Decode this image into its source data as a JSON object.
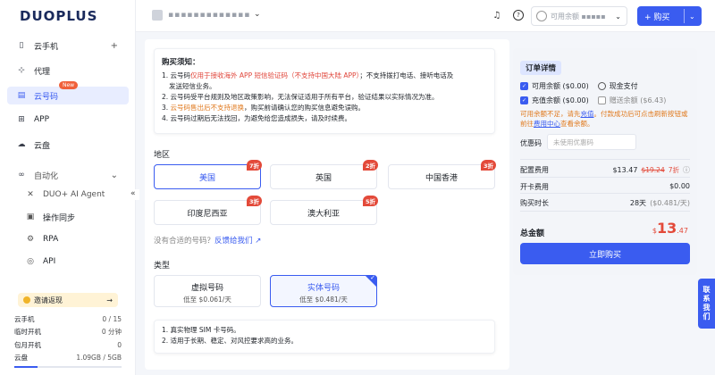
{
  "brand": {
    "logo": "DUOPLUS"
  },
  "sidebar": {
    "items": [
      {
        "label": "云手机",
        "icon": "phone-icon",
        "right": "+"
      },
      {
        "label": "代理",
        "icon": "network-icon"
      },
      {
        "label": "云号码",
        "icon": "sim-icon",
        "badge": "New"
      },
      {
        "label": "APP",
        "icon": "apps-grid-icon"
      },
      {
        "label": "云盘",
        "icon": "cloud-icon"
      },
      {
        "label": "自动化",
        "icon": "automation-icon",
        "right": "⌄"
      }
    ],
    "sub_items": [
      {
        "label": "DUO+ AI Agent",
        "icon": "ai-agent-icon"
      },
      {
        "label": "操作同步",
        "icon": "sync-icon"
      },
      {
        "label": "RPA",
        "icon": "rpa-icon"
      },
      {
        "label": "API",
        "icon": "api-icon"
      }
    ],
    "invite": {
      "label": "邀请返现",
      "arrow": "→"
    },
    "stats": [
      {
        "label": "云手机",
        "value": "0 / 15"
      },
      {
        "label": "临时开机",
        "value": "0 分钟"
      },
      {
        "label": "包月开机",
        "value": "0"
      },
      {
        "label": "云盘",
        "value": "1.09GB / 5GB"
      }
    ],
    "disk_usage_fraction": 0.218
  },
  "header": {
    "account_name": "▪▪▪▪▪▪▪▪▪▪▪▪▪",
    "balance_label": "可用余额 ▪▪▪▪▪",
    "buy_label": "+ 购买"
  },
  "notice": {
    "title": "购买须知：",
    "lines": [
      {
        "pre": "1. 云号码",
        "hl": "仅用于接收海外 APP 短信验证码（不支持中国大陆 APP）",
        "post": "；不支持拨打电话、接听电话及"
      },
      {
        "pre": "发送短信业务。",
        "hl": "",
        "post": ""
      },
      {
        "pre": "2. 云号码受平台规则及地区政策影响，无法保证适用于所有平台，验证结果以实际情况为准。",
        "hl": "",
        "post": ""
      },
      {
        "pre": "3. ",
        "hl": "云号码售出后不支持退换",
        "post": "，购买前请确认您的购买信息避免误购。"
      },
      {
        "pre": "4. 云号码过期后无法找回，为避免给您造成损失，请及时续费。",
        "hl": "",
        "post": ""
      }
    ]
  },
  "region": {
    "label": "地区",
    "options": [
      {
        "name": "美国",
        "discount": "7折",
        "selected": true
      },
      {
        "name": "英国",
        "discount": "2折",
        "selected": false
      },
      {
        "name": "中国香港",
        "discount": "3折",
        "selected": false
      },
      {
        "name": "印度尼西亚",
        "discount": "3折",
        "selected": false
      },
      {
        "name": "澳大利亚",
        "discount": "5折",
        "selected": false
      }
    ],
    "feedback_pre": "没有合适的号码？",
    "feedback_link": "反馈给我们"
  },
  "type": {
    "label": "类型",
    "options": [
      {
        "name": "虚拟号码",
        "price": "低至 $0.061/天",
        "selected": false
      },
      {
        "name": "实体号码",
        "price": "低至 $0.481/天",
        "selected": true
      }
    ],
    "features": [
      "1. 真实物理 SIM 卡号码。",
      "2. 适用于长期、稳定、对风控要求高的业务。"
    ]
  },
  "order": {
    "title": "订单详情",
    "pay_balance": "可用余额 ($0.00)",
    "pay_cash": "现金支付",
    "recharge_balance": "充值余额 ($0.00)",
    "gift_balance": "赠送余额 ($6.43)",
    "warn_pre": "可用余额不足，请先",
    "warn_link1": "充值",
    "warn_mid": "。付款成功后可点击刷新按钮或前往",
    "warn_link2": "费用中心",
    "warn_post": "查看余额。",
    "coupon_label": "优惠码",
    "coupon_placeholder": "未使用优惠码",
    "config_fee_label": "配置费用",
    "config_fee": "$13.47",
    "config_fee_orig": "$19.24",
    "config_discount": "7折",
    "setup_fee_label": "开卡费用",
    "setup_fee": "$0.00",
    "duration_label": "购买时长",
    "duration": "28天",
    "duration_rate": "($0.481/天)",
    "total_label": "总金额",
    "total_currency": "$",
    "total_int": "13",
    "total_dec": ".47",
    "buy_now": "立即购买"
  },
  "contact": {
    "label": "联系我们"
  },
  "colors": {
    "accent": "#3a5cf0",
    "discount": "#e34a3a",
    "warning": "#e07a1f"
  }
}
